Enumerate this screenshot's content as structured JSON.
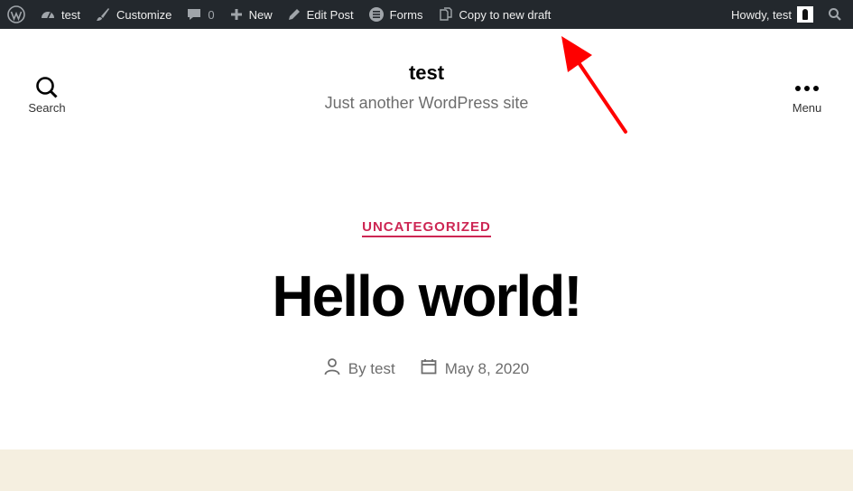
{
  "adminbar": {
    "site_name": "test",
    "customize_label": "Customize",
    "comments_count": "0",
    "new_label": "New",
    "edit_post_label": "Edit Post",
    "forms_label": "Forms",
    "copy_label": "Copy to new draft",
    "howdy_label": "Howdy, test"
  },
  "header": {
    "search_label": "Search",
    "menu_label": "Menu",
    "site_title": "test",
    "site_description": "Just another WordPress site"
  },
  "post": {
    "category": "UNCATEGORIZED",
    "title": "Hello world!",
    "author": "By test",
    "date": "May 8, 2020"
  },
  "colors": {
    "adminbar_bg": "#23282d",
    "accent": "#cd2653",
    "annotation_arrow": "#ff0000",
    "footer_band": "#f5efe0"
  },
  "icons": [
    "wordpress-logo-icon",
    "dashboard-icon",
    "brush-icon",
    "comment-icon",
    "plus-icon",
    "pencil-icon",
    "forms-icon",
    "copy-icon",
    "avatar",
    "search-icon",
    "menu-dots-icon",
    "person-icon",
    "calendar-icon",
    "annotation-arrow"
  ]
}
